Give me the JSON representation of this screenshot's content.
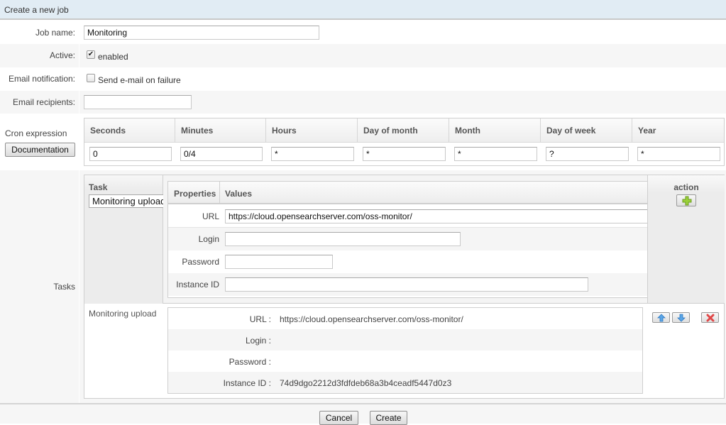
{
  "header": {
    "title": "Create a new job"
  },
  "form": {
    "job_name": {
      "label": "Job name:",
      "value": "Monitoring"
    },
    "active": {
      "label": "Active:",
      "checkbox_label": "enabled",
      "checked": true
    },
    "email_notification": {
      "label": "Email notification:",
      "checkbox_label": "Send e-mail on failure",
      "checked": false
    },
    "email_recipients": {
      "label": "Email recipients:",
      "value": ""
    }
  },
  "cron": {
    "label": "Cron expression",
    "documentation_button": "Documentation",
    "columns": [
      {
        "header": "Seconds",
        "value": "0"
      },
      {
        "header": "Minutes",
        "value": "0/4"
      },
      {
        "header": "Hours",
        "value": "*"
      },
      {
        "header": "Day of month",
        "value": "*"
      },
      {
        "header": "Month",
        "value": "*"
      },
      {
        "header": "Day of week",
        "value": "?"
      },
      {
        "header": "Year",
        "value": "*"
      }
    ]
  },
  "tasks": {
    "label": "Tasks",
    "task_header": "Task",
    "task_select_value": "Monitoring upload",
    "properties_header": "Properties",
    "values_header": "Values",
    "action_header": "action",
    "properties": [
      {
        "key": "URL",
        "value": "https://cloud.opensearchserver.com/oss-monitor/"
      },
      {
        "key": "Login",
        "value": ""
      },
      {
        "key": "Password",
        "value": ""
      },
      {
        "key": "Instance ID",
        "value": ""
      }
    ],
    "existing": {
      "name": "Monitoring upload",
      "rows": [
        {
          "key": "URL :",
          "value": "https://cloud.opensearchserver.com/oss-monitor/"
        },
        {
          "key": "Login :",
          "value": ""
        },
        {
          "key": "Password :",
          "value": ""
        },
        {
          "key": "Instance ID :",
          "value": "74d9dgo2212d3fdfdeb68a3b4ceadf5447d0z3"
        }
      ]
    }
  },
  "footer": {
    "cancel": "Cancel",
    "create": "Create"
  }
}
